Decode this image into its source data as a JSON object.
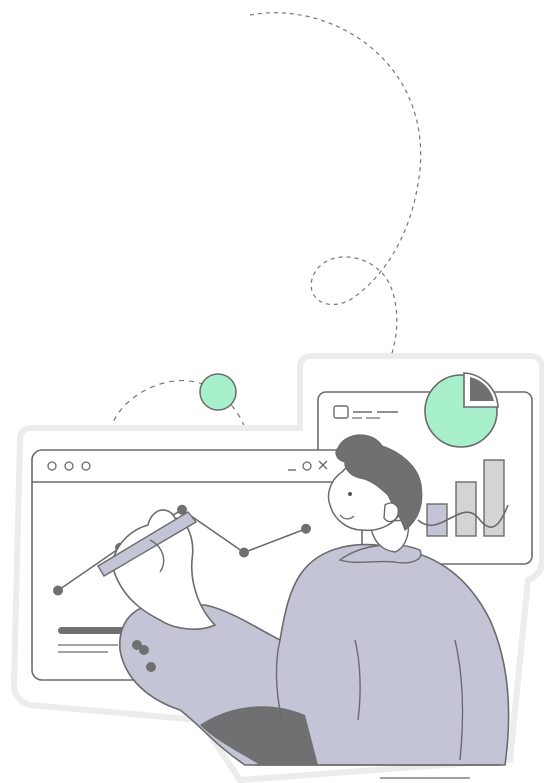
{
  "colors": {
    "outline": "#6b6b6b",
    "dark": "#707072",
    "mint": "#a8f0cb",
    "lavender": "#c3c5d6",
    "bar_gray": "#d4d4d4",
    "sticker_shadow": "#eeeeee"
  },
  "illustration": {
    "left_window": {
      "controls": [
        "dot",
        "dot",
        "dot"
      ],
      "right_controls": [
        "minimize-icon",
        "restore-icon",
        "close-icon"
      ]
    },
    "line_chart": {
      "type": "line",
      "points": [
        {
          "x": 1,
          "y": 1
        },
        {
          "x": 2,
          "y": 2.8
        },
        {
          "x": 3,
          "y": 4.4
        },
        {
          "x": 4,
          "y": 2.6
        },
        {
          "x": 5,
          "y": 3.6
        }
      ]
    },
    "right_window": {
      "pie_chart": {
        "type": "pie",
        "slices": [
          0.75,
          0.25
        ]
      },
      "bar_chart": {
        "type": "bar",
        "values": [
          2,
          3.5,
          5
        ]
      }
    },
    "icons": [
      "pen-icon",
      "sparkle-circle-icon"
    ]
  }
}
